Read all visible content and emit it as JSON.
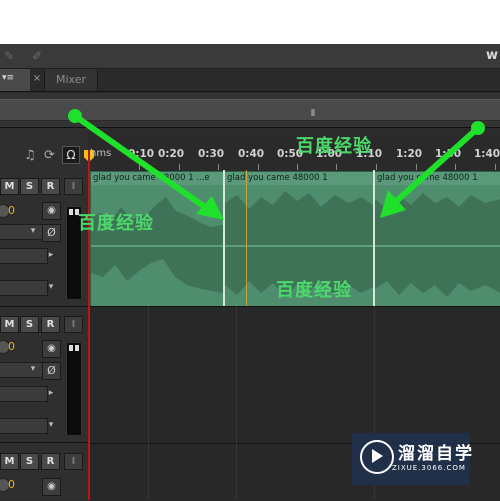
{
  "toolbar": {
    "right_glyph": "w"
  },
  "tabs": {
    "active_label": "",
    "mixer_label": "Mixer",
    "close_glyph": "×"
  },
  "overview": {
    "handle_glyph": "⦀"
  },
  "ruler": {
    "unit_label": "hms",
    "ticks": [
      "0:10",
      "0:20",
      "0:30",
      "0:40",
      "0:50",
      "1:00",
      "1:10",
      "1:20",
      "1:30",
      "1:40"
    ]
  },
  "tracks": [
    {
      "mute": "M",
      "solo": "S",
      "record": "R",
      "input": "I",
      "volume": "0"
    },
    {
      "mute": "M",
      "solo": "S",
      "record": "R",
      "input": "I",
      "volume": "0"
    },
    {
      "mute": "M",
      "solo": "S",
      "record": "R",
      "input": "I",
      "volume": "0"
    }
  ],
  "clips": [
    {
      "label": "glad you came 48000 1 ...e"
    },
    {
      "label": "glad you came 48000 1"
    },
    {
      "label": "glad you came 48000 1"
    }
  ],
  "watermarks": {
    "text1": "百度经验",
    "text2": "百度经验",
    "text3": "百度经验"
  },
  "logo": {
    "title": "溜溜自学",
    "subtitle": "ZIXUE.3066.COM"
  },
  "colors": {
    "clip_fill": "#4f8d6f",
    "arrow": "#1fe02a",
    "playhead": "#c01414"
  }
}
